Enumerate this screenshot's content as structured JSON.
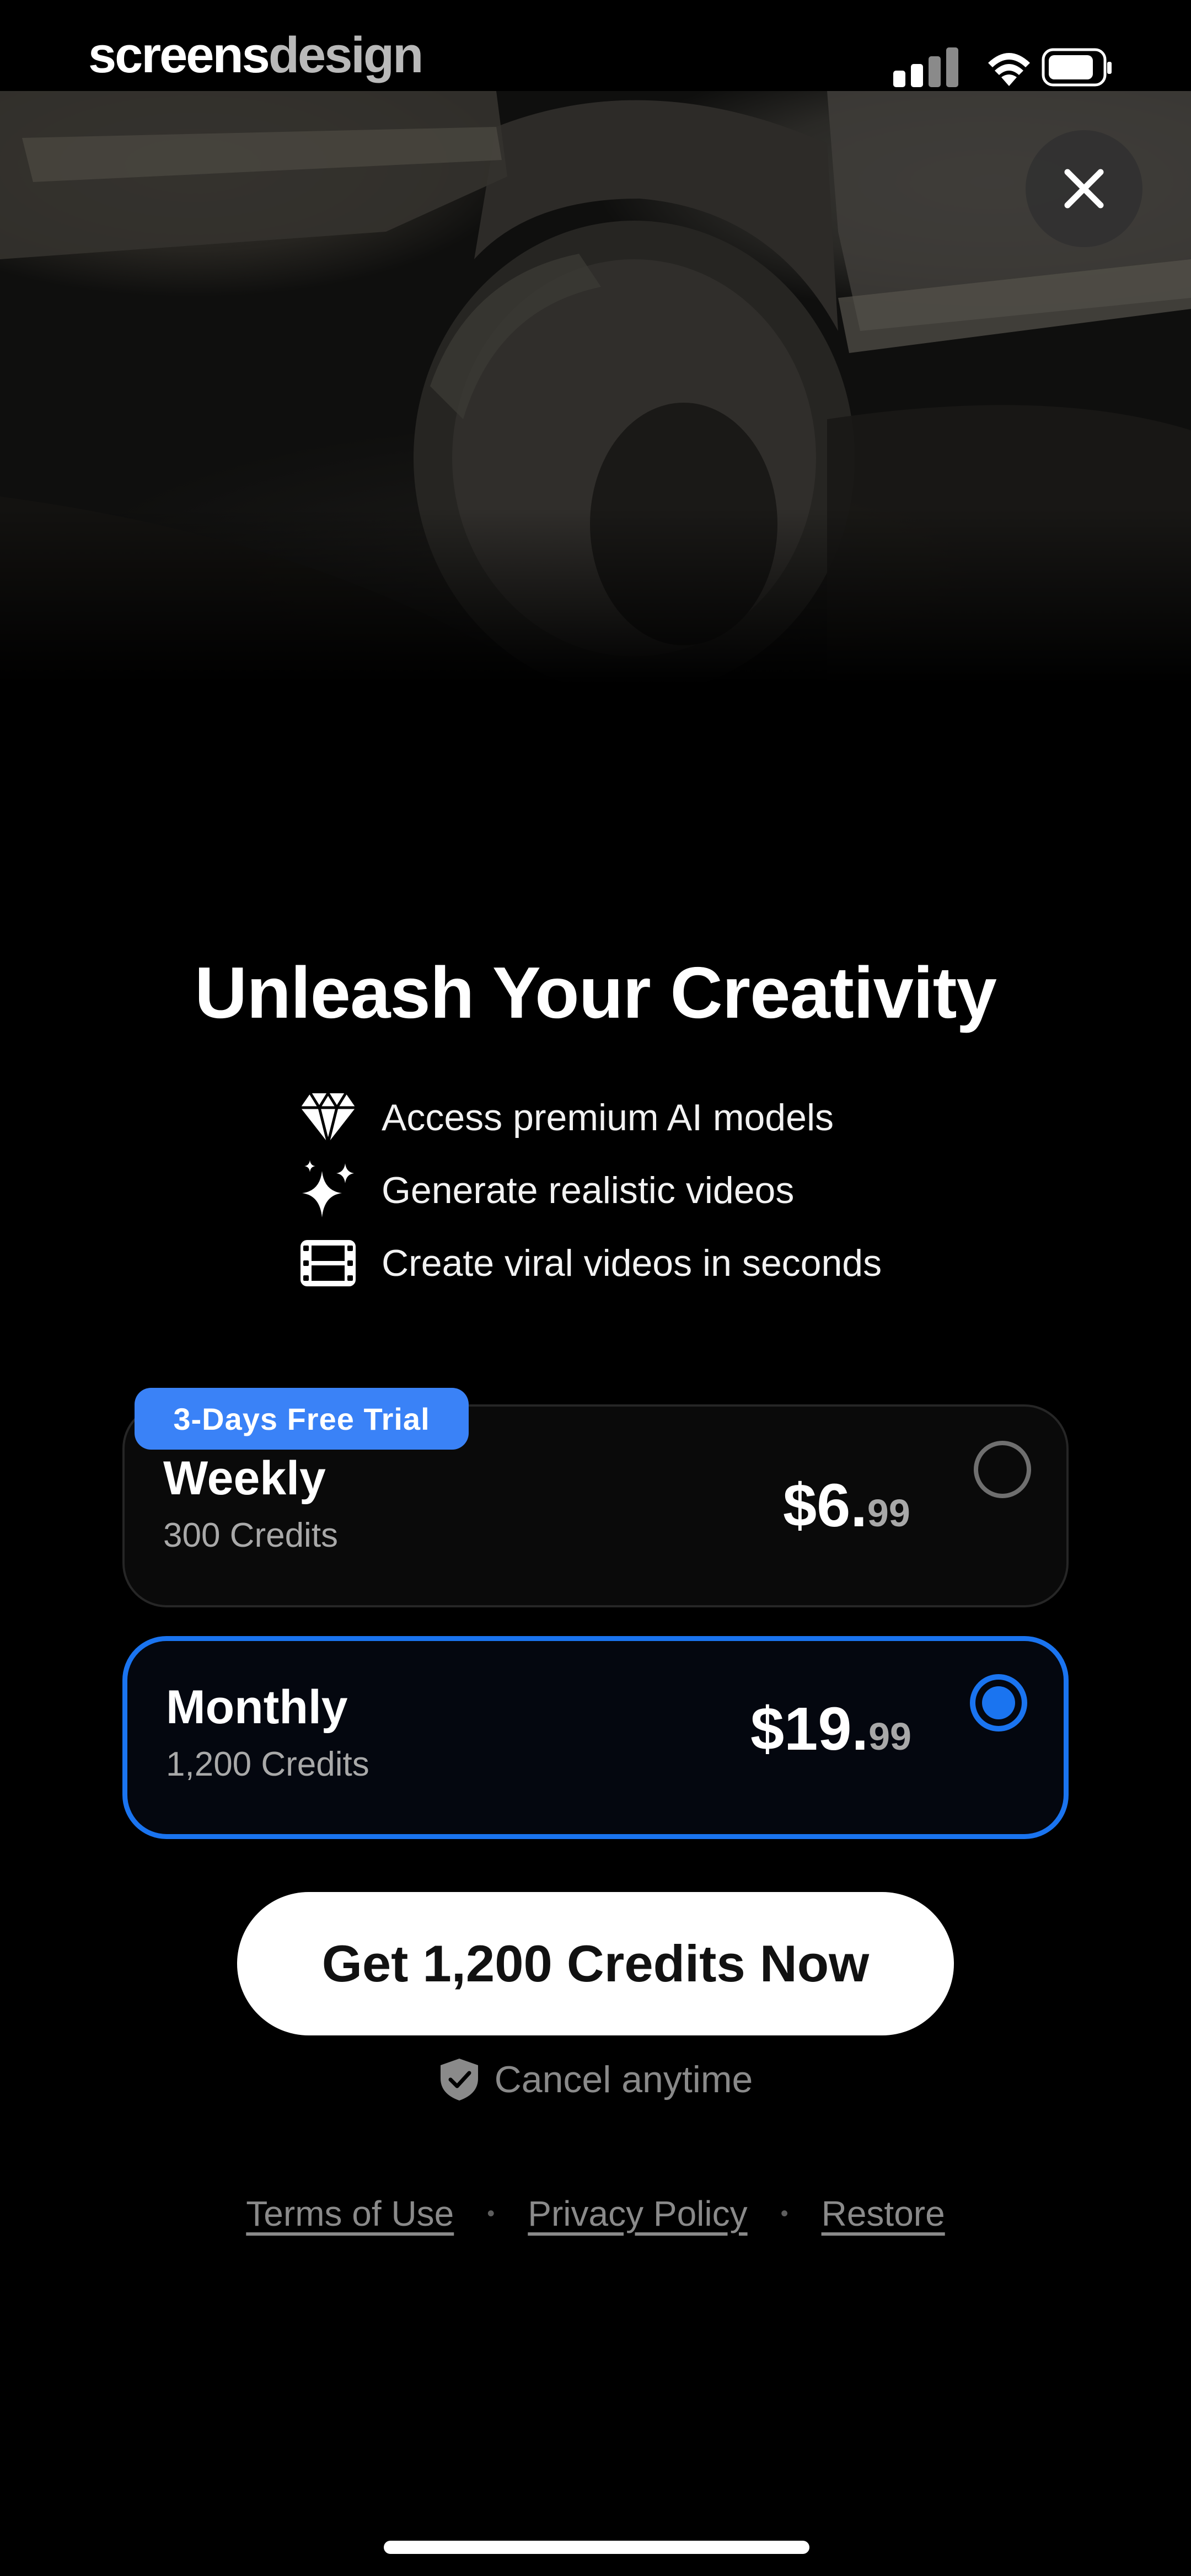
{
  "status_bar": {
    "brand_part1": "screens",
    "brand_part2": "design"
  },
  "hero": {
    "image": "muddy-offroad-truck-wheel"
  },
  "paywall": {
    "title": "Unleash Your Creativity",
    "features": [
      {
        "icon": "diamond-icon",
        "text": "Access premium AI models"
      },
      {
        "icon": "sparkles-icon",
        "text": "Generate realistic videos"
      },
      {
        "icon": "film-icon",
        "text": "Create viral videos in seconds"
      }
    ],
    "plans": [
      {
        "badge": "3-Days Free Trial",
        "name": "Weekly",
        "credits": "300 Credits",
        "price_whole": "$6.",
        "price_cents": "99",
        "selected": false
      },
      {
        "name": "Monthly",
        "credits": "1,200 Credits",
        "price_whole": "$19.",
        "price_cents": "99",
        "selected": true
      }
    ],
    "cta_label": "Get 1,200 Credits Now",
    "cancel_text": "Cancel anytime",
    "footer": {
      "terms": "Terms of Use",
      "privacy": "Privacy Policy",
      "restore": "Restore",
      "separator": "•"
    }
  },
  "colors": {
    "accent": "#1a74f0",
    "badge": "#3a82f7",
    "background": "#000000"
  }
}
